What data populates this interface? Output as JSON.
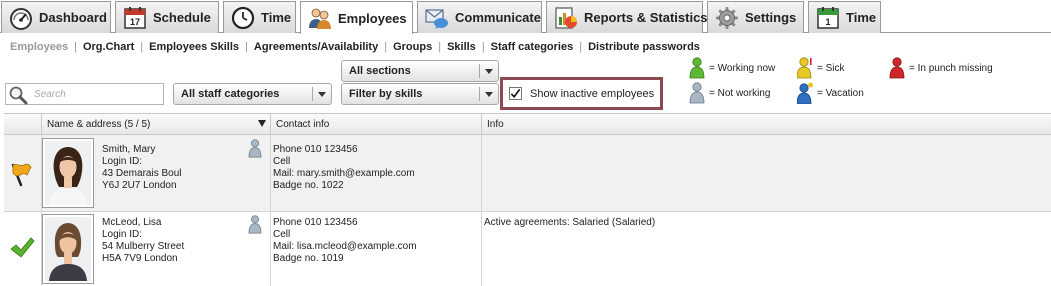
{
  "tabs": [
    {
      "label": "Dashboard",
      "icon": "speedometer-icon"
    },
    {
      "label": "Schedule",
      "icon": "calendar-icon",
      "calendar_day": "17"
    },
    {
      "label": "Time",
      "icon": "clock-icon"
    },
    {
      "label": "Employees",
      "icon": "employees-icon"
    },
    {
      "label": "Communicate",
      "icon": "envelope-chat-icon"
    },
    {
      "label": "Reports & Statistics",
      "icon": "report-chart-icon"
    },
    {
      "label": "Settings",
      "icon": "gear-icon"
    },
    {
      "label": "Time",
      "icon": "calendar-check-icon",
      "calendar_day": "1"
    }
  ],
  "active_tab": "Employees",
  "subnav": [
    "Employees",
    "Org.Chart",
    "Employees Skills",
    "Agreements/Availability",
    "Groups",
    "Skills",
    "Staff categories",
    "Distribute passwords"
  ],
  "search": {
    "placeholder": "Search"
  },
  "filters": {
    "staff_categories": "All staff categories",
    "sections": "All sections",
    "skills": "Filter by skills"
  },
  "show_inactive": {
    "label": "Show inactive employees",
    "checked": true
  },
  "legend": {
    "working_now": "= Working now",
    "not_working": "= Not working",
    "sick": "= Sick",
    "vacation": "= Vacation",
    "in_punch_missing": "= In punch missing"
  },
  "legend_colors": {
    "working_now": "#5fb833",
    "not_working": "#9aa9b8",
    "sick": "#e2c21e",
    "vacation": "#2e6fc0",
    "in_punch_missing": "#d0262b"
  },
  "table": {
    "columns": [
      "Name & address (5 / 5)",
      "Contact info",
      "Info"
    ],
    "rows": [
      {
        "status_icon": "flag-icon",
        "name": "Smith, Mary",
        "login": "Login ID:",
        "street": "43 Demarais Boul",
        "city": "Y6J 2U7 London",
        "contact": [
          "Phone 010 123456",
          "Cell",
          "Mail: mary.smith@example.com",
          "Badge no. 1022"
        ],
        "info": ""
      },
      {
        "status_icon": "checkmark-icon",
        "name": "McLeod, Lisa",
        "login": "Login ID:",
        "street": "54 Mulberry Street",
        "city": "H5A 7V9 London",
        "contact": [
          "Phone 010 123456",
          "Cell",
          "Mail: lisa.mcleod@example.com",
          "Badge no. 1019"
        ],
        "info": "Active agreements: Salaried (Salaried)"
      }
    ]
  }
}
